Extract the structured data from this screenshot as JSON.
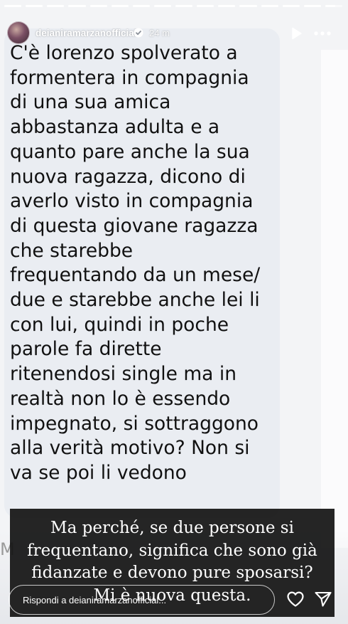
{
  "header": {
    "username": "deianiramarzanofficial",
    "time": "24 m",
    "icons": [
      "avatar",
      "verified-badge-icon",
      "play-icon",
      "more-icon"
    ]
  },
  "progress": {
    "segments": 16,
    "current_index": 15,
    "current_fill": 0.6
  },
  "message": {
    "text": "C'è lorenzo spolverato a\nformentera in compagnia\ndi una sua amica\nabbastanza adulta e a\nquanto pare anche la sua\nnuova ragazza, dicono di\naverlo visto in compagnia\ndi questa giovane ragazza\nche starebbe\nfrequentando da un mese/\ndue e starebbe anche lei li\ncon lui, quindi in poche\nparole fa dirette\nritenendosi single ma in\nrealtà non lo è essendo\nimpegnato, si sottraggono\nalla verità motivo? Non si\nva se poi li vedono"
  },
  "peek_text": "M",
  "caption": {
    "text": "Ma perché, se due persone si\nfrequentano, significa che sono già\nfidanzate e devono pure sposarsi?\nMi è nuova questa."
  },
  "reply_bar": {
    "placeholder": "Rispondi a deianiramarzanofficial..."
  },
  "colors": {
    "background": "#f3f4f6",
    "bubble": "#eaedf2",
    "caption_bg": "#141414",
    "text": "#111111"
  }
}
